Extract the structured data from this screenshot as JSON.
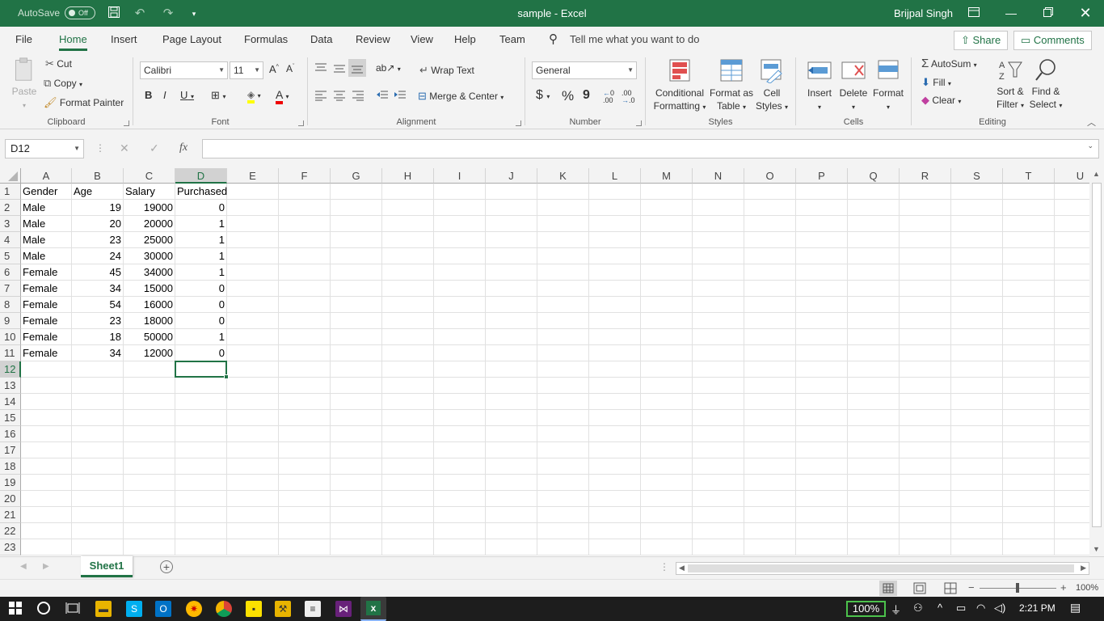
{
  "titlebar": {
    "autosave_label": "AutoSave",
    "autosave_state": "Off",
    "title": "sample  -  Excel",
    "user": "Brijpal Singh",
    "accent_color": "#217346"
  },
  "menu": {
    "tabs": [
      "File",
      "Home",
      "Insert",
      "Page Layout",
      "Formulas",
      "Data",
      "Review",
      "View",
      "Help",
      "Team"
    ],
    "active_tab": "Home",
    "tell_me": "Tell me what you want to do",
    "share": "Share",
    "comments": "Comments"
  },
  "ribbon": {
    "clipboard": {
      "paste": "Paste",
      "cut": "Cut",
      "copy": "Copy",
      "format_painter": "Format Painter",
      "label": "Clipboard"
    },
    "font": {
      "name": "Calibri",
      "size": "11",
      "label": "Font",
      "grow": "A",
      "shrink": "A",
      "bold": "B",
      "italic": "I",
      "underline": "U",
      "font_color_glyph": "A"
    },
    "alignment": {
      "wrap_text": "Wrap Text",
      "merge_center": "Merge & Center",
      "label": "Alignment"
    },
    "number": {
      "format": "General",
      "currency": "$",
      "percent": "%",
      "comma": "9",
      "inc_decimal": ".00",
      "dec_decimal": ".0",
      "label": "Number"
    },
    "styles": {
      "conditional_line1": "Conditional",
      "conditional_line2": "Formatting",
      "format_table_line1": "Format as",
      "format_table_line2": "Table",
      "cell_styles_line1": "Cell",
      "cell_styles_line2": "Styles",
      "label": "Styles"
    },
    "cells": {
      "insert": "Insert",
      "delete": "Delete",
      "format": "Format",
      "label": "Cells"
    },
    "editing": {
      "autosum": "AutoSum",
      "fill": "Fill",
      "clear": "Clear",
      "sort_line1": "Sort &",
      "sort_line2": "Filter",
      "find_line1": "Find &",
      "find_line2": "Select",
      "label": "Editing"
    }
  },
  "formula_bar": {
    "name_box": "D12",
    "fx": "fx",
    "formula": ""
  },
  "grid": {
    "columns": [
      "A",
      "B",
      "C",
      "D",
      "E",
      "F",
      "G",
      "H",
      "I",
      "J",
      "K",
      "L",
      "M",
      "N",
      "O",
      "P",
      "Q",
      "R",
      "S",
      "T",
      "U"
    ],
    "selected_column": "D",
    "rows": [
      "1",
      "2",
      "3",
      "4",
      "5",
      "6",
      "7",
      "8",
      "9",
      "10",
      "11",
      "12",
      "13",
      "14",
      "15",
      "16",
      "17",
      "18",
      "19",
      "20",
      "21",
      "22",
      "23"
    ],
    "selected_row": "12",
    "headers": [
      "Gender",
      "Age",
      "Salary",
      "Purchased"
    ],
    "data": [
      [
        "Male",
        "19",
        "19000",
        "0"
      ],
      [
        "Male",
        "20",
        "20000",
        "1"
      ],
      [
        "Male",
        "23",
        "25000",
        "1"
      ],
      [
        "Male",
        "24",
        "30000",
        "1"
      ],
      [
        "Female",
        "45",
        "34000",
        "1"
      ],
      [
        "Female",
        "34",
        "15000",
        "0"
      ],
      [
        "Female",
        "54",
        "16000",
        "0"
      ],
      [
        "Female",
        "23",
        "18000",
        "0"
      ],
      [
        "Female",
        "18",
        "50000",
        "1"
      ],
      [
        "Female",
        "34",
        "12000",
        "0"
      ]
    ],
    "active_cell": "D12"
  },
  "sheets": {
    "tabs": [
      "Sheet1"
    ],
    "active": "Sheet1"
  },
  "status": {
    "zoom": "100%"
  },
  "taskbar": {
    "battery": "100%",
    "time": "2:21 PM"
  }
}
